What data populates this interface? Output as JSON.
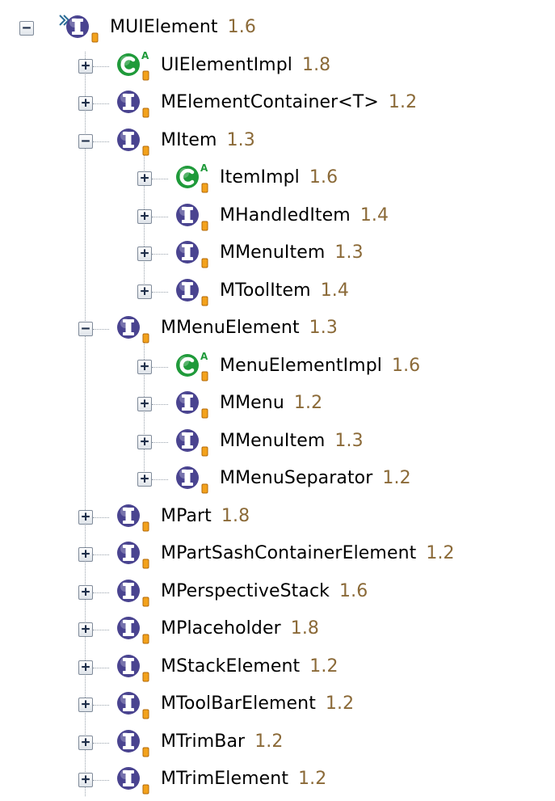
{
  "colors": {
    "interface": "#4a4490",
    "class": "#1f9a3a",
    "badge": "#f3a21c",
    "version": "#8b6a38"
  },
  "tree": [
    {
      "label": "MUIElement",
      "version": "1.6",
      "icon": "interface-icon",
      "expanded": true,
      "depth": 0
    },
    {
      "label": "UIElementImpl",
      "version": "1.8",
      "icon": "class-icon",
      "expanded": false,
      "depth": 1
    },
    {
      "label": "MElementContainer<T>",
      "version": "1.2",
      "icon": "interface-icon",
      "expanded": false,
      "depth": 1
    },
    {
      "label": "MItem",
      "version": "1.3",
      "icon": "interface-icon",
      "expanded": true,
      "depth": 1
    },
    {
      "label": "ItemImpl",
      "version": "1.6",
      "icon": "class-icon",
      "expanded": false,
      "depth": 2
    },
    {
      "label": "MHandledItem",
      "version": "1.4",
      "icon": "interface-icon",
      "expanded": false,
      "depth": 2
    },
    {
      "label": "MMenuItem",
      "version": "1.3",
      "icon": "interface-icon",
      "expanded": false,
      "depth": 2
    },
    {
      "label": "MToolItem",
      "version": "1.4",
      "icon": "interface-icon",
      "expanded": false,
      "depth": 2
    },
    {
      "label": "MMenuElement",
      "version": "1.3",
      "icon": "interface-icon",
      "expanded": true,
      "depth": 1
    },
    {
      "label": "MenuElementImpl",
      "version": "1.6",
      "icon": "class-icon",
      "expanded": false,
      "depth": 2
    },
    {
      "label": "MMenu",
      "version": "1.2",
      "icon": "interface-icon",
      "expanded": false,
      "depth": 2
    },
    {
      "label": "MMenuItem",
      "version": "1.3",
      "icon": "interface-icon",
      "expanded": false,
      "depth": 2
    },
    {
      "label": "MMenuSeparator",
      "version": "1.2",
      "icon": "interface-icon",
      "expanded": false,
      "depth": 2
    },
    {
      "label": "MPart",
      "version": "1.8",
      "icon": "interface-icon",
      "expanded": false,
      "depth": 1
    },
    {
      "label": "MPartSashContainerElement",
      "version": "1.2",
      "icon": "interface-icon",
      "expanded": false,
      "depth": 1
    },
    {
      "label": "MPerspectiveStack",
      "version": "1.6",
      "icon": "interface-icon",
      "expanded": false,
      "depth": 1
    },
    {
      "label": "MPlaceholder",
      "version": "1.8",
      "icon": "interface-icon",
      "expanded": false,
      "depth": 1
    },
    {
      "label": "MStackElement",
      "version": "1.2",
      "icon": "interface-icon",
      "expanded": false,
      "depth": 1
    },
    {
      "label": "MToolBarElement",
      "version": "1.2",
      "icon": "interface-icon",
      "expanded": false,
      "depth": 1
    },
    {
      "label": "MTrimBar",
      "version": "1.2",
      "icon": "interface-icon",
      "expanded": false,
      "depth": 1
    },
    {
      "label": "MTrimElement",
      "version": "1.2",
      "icon": "interface-icon",
      "expanded": false,
      "depth": 1
    }
  ]
}
